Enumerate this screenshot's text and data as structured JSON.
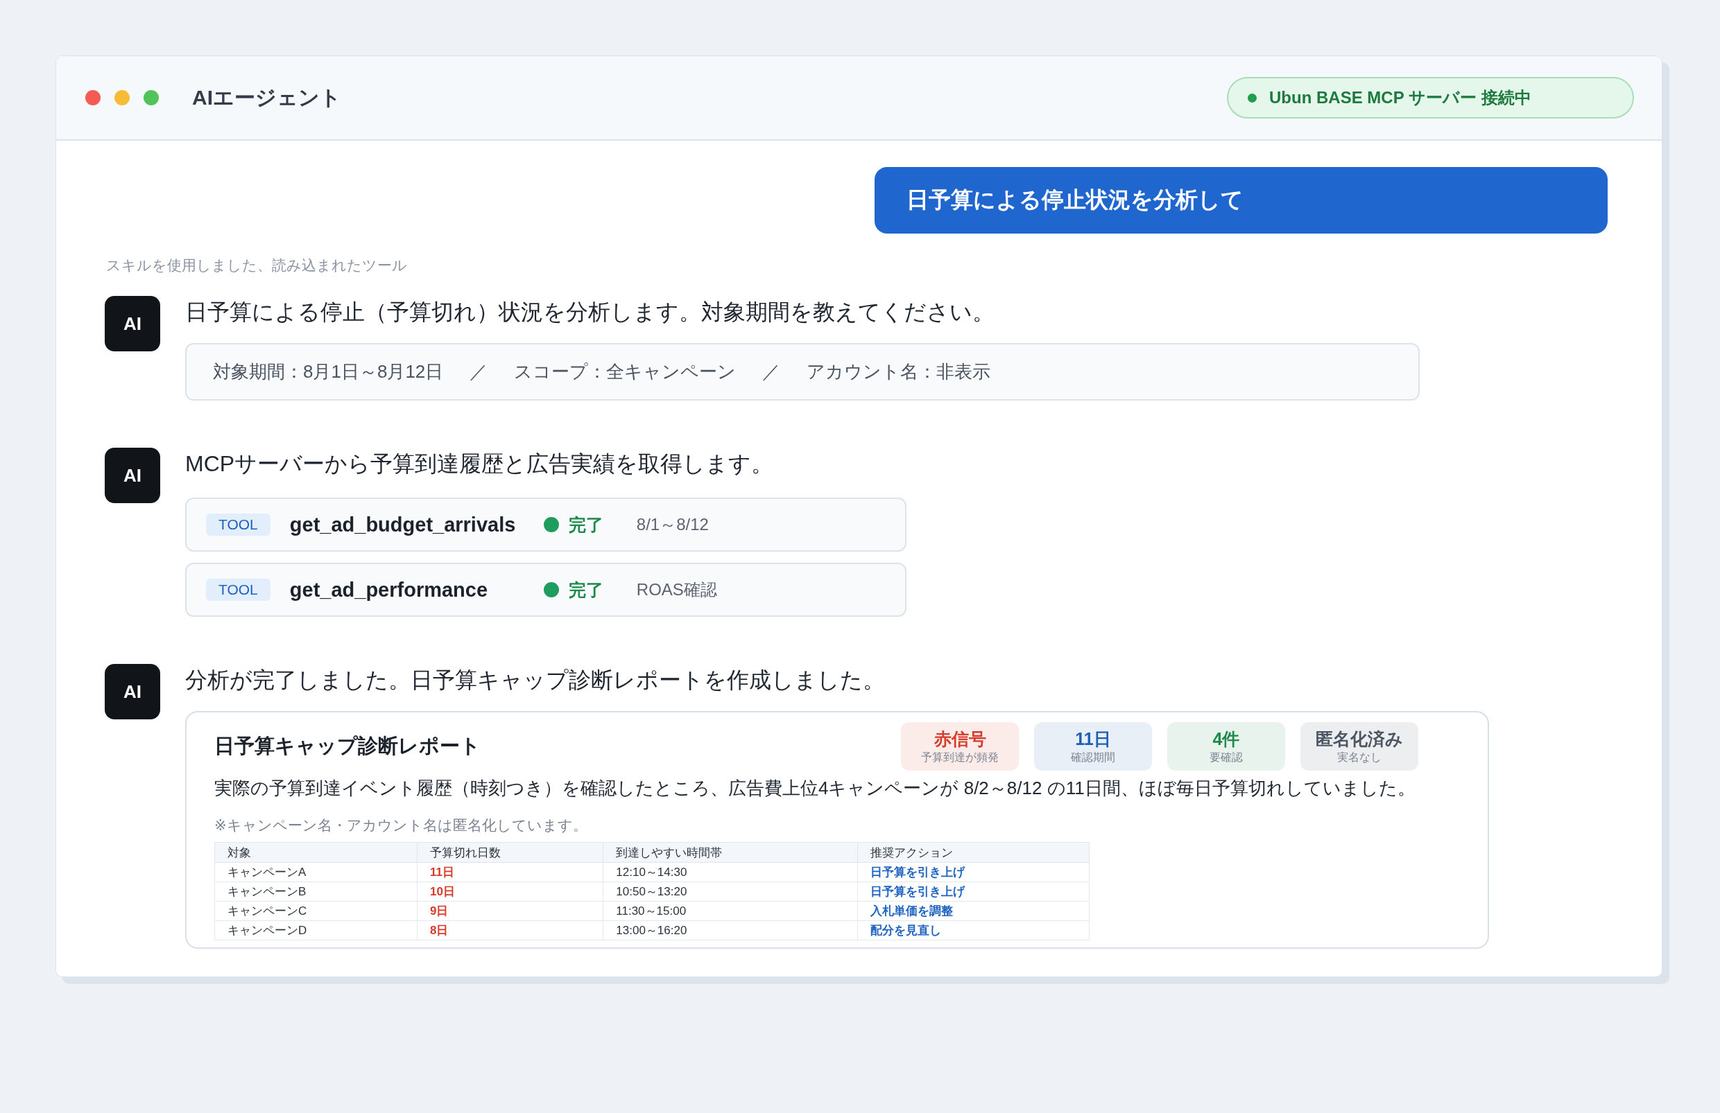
{
  "window": {
    "title": "AIエージェント",
    "connection": {
      "label": "Ubun BASE MCP サーバー 接続中",
      "connected": true
    }
  },
  "user_message": "日予算による停止状況を分析して",
  "status_note": "スキルを使用しました、読み込まれたツール",
  "messages": [
    {
      "kind": "info",
      "avatar": "AI",
      "text": "日予算による停止（予算切れ）状況を分析します。対象期間を教えてください。",
      "info": [
        "対象期間：8月1日～8月12日",
        "／",
        "スコープ：全キャンペーン",
        "／",
        "アカウント名：非表示"
      ]
    },
    {
      "kind": "tools",
      "avatar": "AI",
      "text": "MCPサーバーから予算到達履歴と広告実績を取得します。",
      "tools": [
        {
          "badge": "TOOL",
          "name": "get_ad_budget_arrivals",
          "status": "完了",
          "done": true,
          "detail": "8/1～8/12"
        },
        {
          "badge": "TOOL",
          "name": "get_ad_performance",
          "status": "完了",
          "done": true,
          "detail": "ROAS確認"
        }
      ]
    },
    {
      "kind": "report",
      "avatar": "AI",
      "text": "分析が完了しました。日予算キャップ診断レポートを作成しました。",
      "report": {
        "title": "日予算キャップ診断レポート",
        "stats": [
          {
            "value": "赤信号",
            "label": "予算到達が頻発",
            "color": "#d63b2a"
          },
          {
            "value": "11日",
            "label": "確認期間",
            "color": "#1e5fb3"
          },
          {
            "value": "4件",
            "label": "要確認",
            "color": "#1c8a4a"
          },
          {
            "value": "匿名化済み",
            "label": "実名なし",
            "color": "#4b5563"
          }
        ],
        "summary": "実際の予算到達イベント履歴（時刻つき）を確認したところ、広告費上位4キャンペーンが 8/2～8/12 の11日間、ほぼ毎日予算切れしていました。",
        "note": "※キャンペーン名・アカウント名は匿名化しています。",
        "table": {
          "columns": [
            {
              "label": "対象",
              "kind": "text"
            },
            {
              "label": "予算切れ日数",
              "kind": "alert"
            },
            {
              "label": "到達しやすい時間帯",
              "kind": "text"
            },
            {
              "label": "推奨アクション",
              "kind": "action"
            }
          ],
          "rows": [
            [
              "キャンペーンA",
              "11日",
              "12:10～14:30",
              "日予算を引き上げ"
            ],
            [
              "キャンペーンB",
              "10日",
              "10:50～13:20",
              "日予算を引き上げ"
            ],
            [
              "キャンペーンC",
              "9日",
              "11:30～15:00",
              "入札単価を調整"
            ],
            [
              "キャンペーンD",
              "8日",
              "13:00～16:20",
              "配分を見直し"
            ]
          ]
        }
      }
    }
  ]
}
